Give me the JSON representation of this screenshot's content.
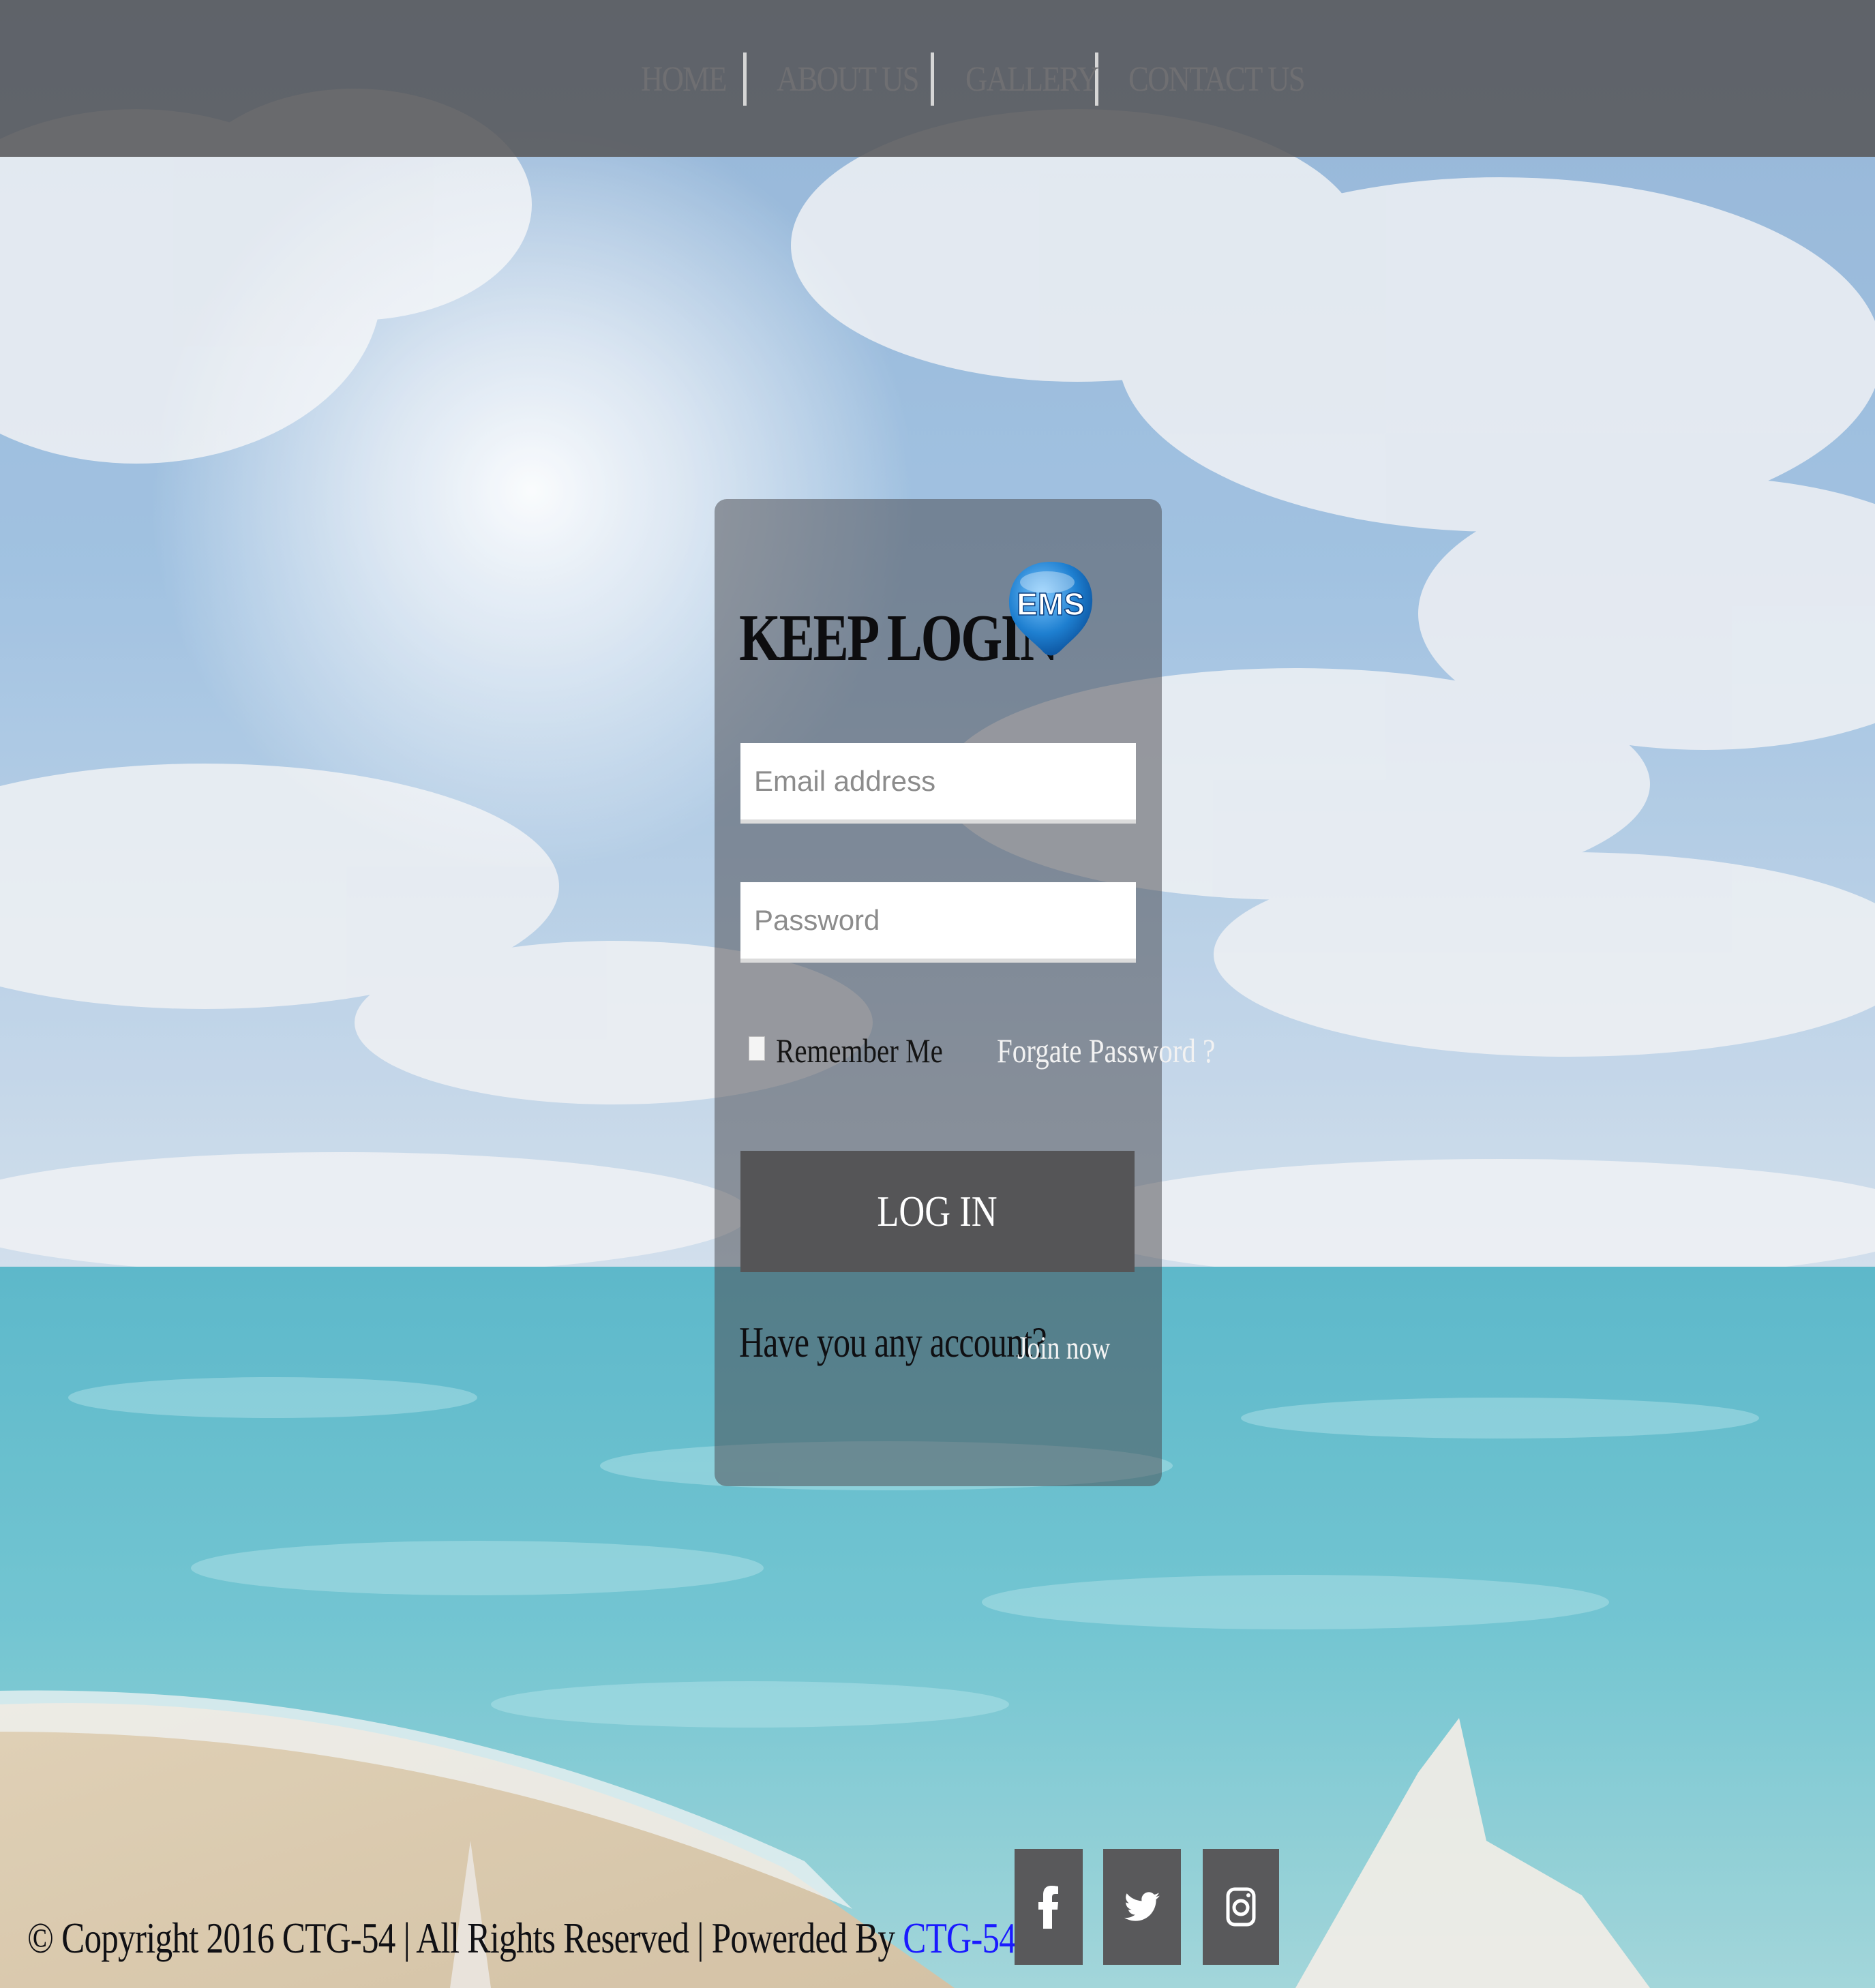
{
  "nav": {
    "items": [
      {
        "label": "HOME"
      },
      {
        "label": "ABOUT US"
      },
      {
        "label": "GALLERY"
      },
      {
        "label": "CONTACT US"
      }
    ]
  },
  "login": {
    "title": "KEEP LOGIN",
    "logo_text": "EMS",
    "email_placeholder": "Email address",
    "password_placeholder": "Password",
    "remember_label": "Remember Me",
    "remember_checked": false,
    "forgot_label": "Forgate Password ?",
    "button_label": "LOG IN",
    "signup_prompt": "Have you any account?",
    "join_label": "Join now"
  },
  "footer": {
    "copyright": "© Copyright 2016 CTG-54 | All Rights Reserved | Powerded By",
    "powered_by": "CTG-54",
    "social": [
      {
        "icon": "facebook-icon"
      },
      {
        "icon": "twitter-icon"
      },
      {
        "icon": "instagram-icon"
      }
    ]
  },
  "colors": {
    "nav_background": "#58585a",
    "card_background": "#4b4b50",
    "button_background": "#555557",
    "powered_link": "#1a1aff",
    "logo_blue": "#1e7fd0"
  }
}
